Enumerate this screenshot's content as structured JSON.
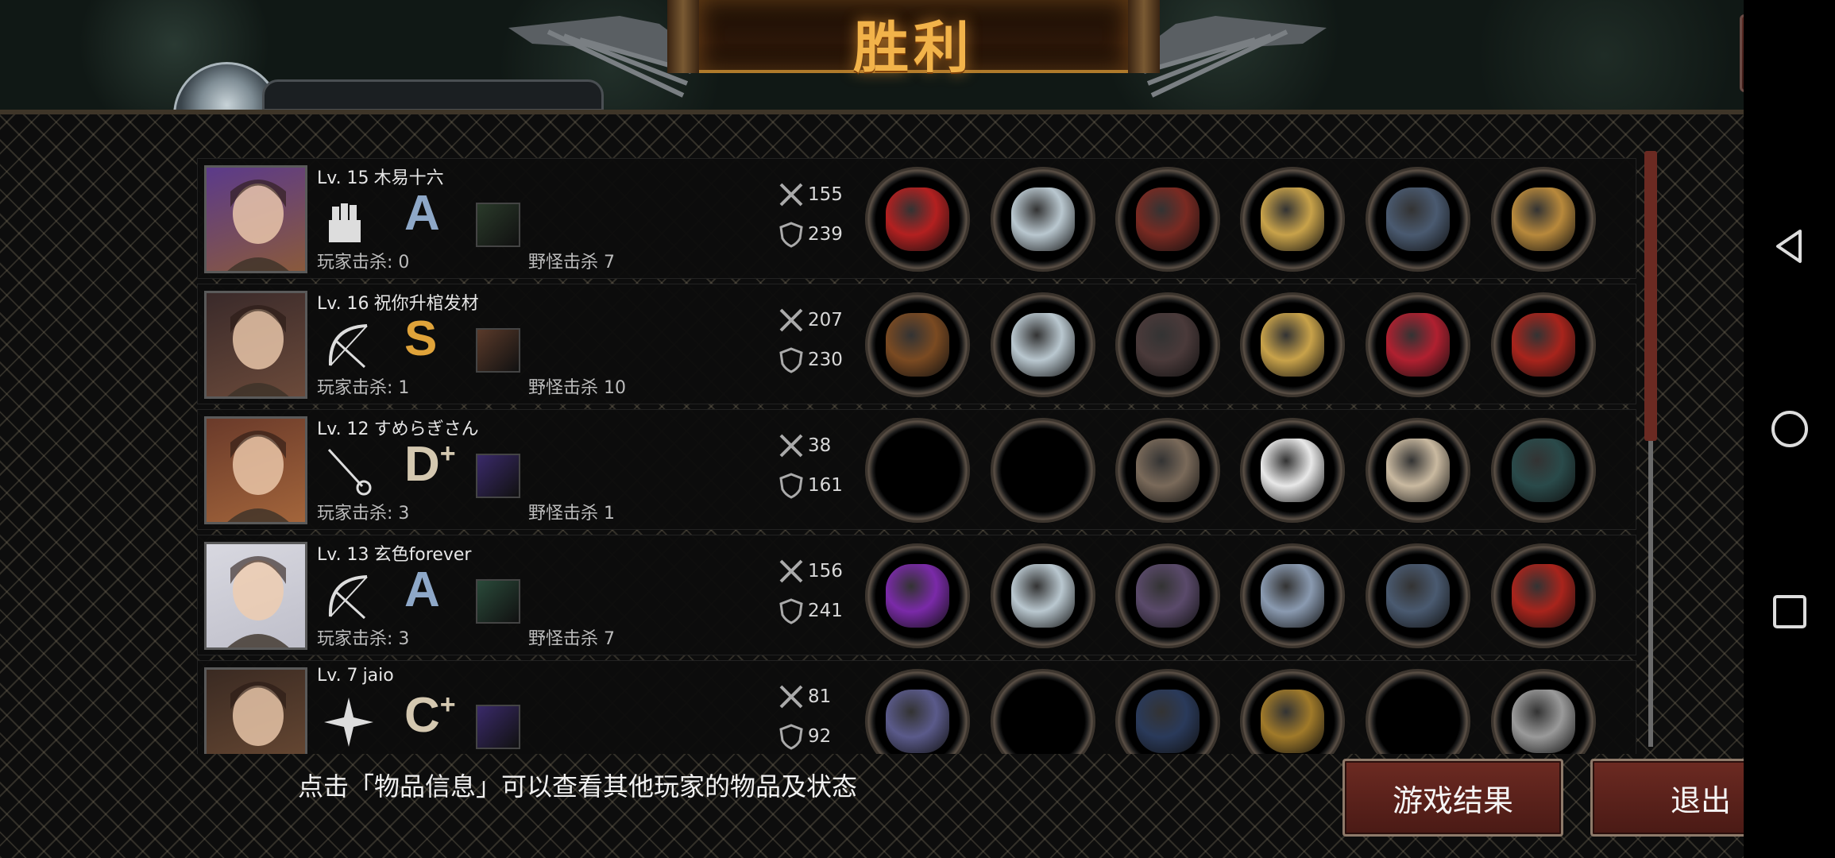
{
  "title": "胜利",
  "hint": "点击「物品信息」可以查看其他玩家的物品及状态",
  "buttons": {
    "result": "游戏结果",
    "exit": "退出"
  },
  "icons": {
    "share": "share-icon",
    "attack": "crossed-swords-icon",
    "defense": "shield-icon"
  },
  "players": [
    {
      "level": "Lv. 15",
      "name": "木易十六",
      "class_icon": "fist-icon",
      "grade": "A",
      "grade_sup": "",
      "player_kills": "玩家击杀: 0",
      "monster_kills": "野怪击杀 7",
      "attack": "155",
      "defense": "239",
      "items": [
        "red-weapon",
        "silver-helmet",
        "red-armor",
        "gold-bracelet",
        "blue-boots",
        "wooden-crate"
      ]
    },
    {
      "level": "Lv. 16",
      "name": "祝你升棺发材",
      "class_icon": "bow-icon",
      "grade": "S",
      "grade_sup": "",
      "player_kills": "玩家击杀: 1",
      "monster_kills": "野怪击杀 10",
      "attack": "207",
      "defense": "230",
      "items": [
        "crossbow",
        "silver-helmet",
        "dark-armor",
        "gold-bracelet",
        "red-heels",
        "red-quiver"
      ]
    },
    {
      "level": "Lv. 12",
      "name": "すめらぎさん",
      "class_icon": "rapier-icon",
      "grade": "D",
      "grade_sup": "+",
      "player_kills": "玩家击杀: 3",
      "monster_kills": "野怪击杀 1",
      "attack": "38",
      "defense": "161",
      "items": [
        "",
        "",
        "chain-armor",
        "white-wristband",
        "sneakers",
        "scope"
      ]
    },
    {
      "level": "Lv. 13",
      "name": "玄色forever",
      "class_icon": "bow-icon",
      "grade": "A",
      "grade_sup": "",
      "player_kills": "玩家击杀: 3",
      "monster_kills": "野怪击杀 7",
      "attack": "156",
      "defense": "241",
      "items": [
        "purple-bow",
        "silver-helmet",
        "purple-armor",
        "watch",
        "blue-boots",
        "red-quiver"
      ]
    },
    {
      "level": "Lv. 7",
      "name": "jaio",
      "class_icon": "shuriken-icon",
      "grade": "C",
      "grade_sup": "+",
      "player_kills": "",
      "monster_kills": "",
      "attack": "81",
      "defense": "92",
      "items": [
        "chakram",
        "",
        "suit",
        "canister",
        "",
        "metal-plate"
      ]
    }
  ]
}
